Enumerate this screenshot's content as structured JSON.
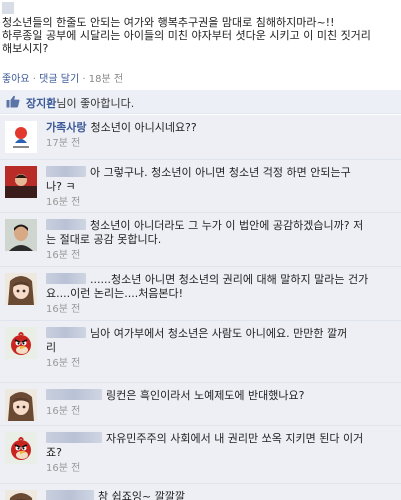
{
  "post": {
    "lines": [
      "청소년들의 한줄도 안되는 여가와 행복추구권을 맘대로 침해하지마라~!!",
      "하루종일 공부에 시달리는 아이들의 미친 야자부터 셧다운 시키고 이 미친 짓거리",
      "해보시지?"
    ],
    "actions": {
      "like": "좋아요",
      "sep": "·",
      "reply": "댓글 달기",
      "time": "18분 전"
    }
  },
  "likes": {
    "name": "장지환",
    "suffix": "님이 좋아합니다."
  },
  "comments": [
    {
      "author": "가족사랑",
      "author_blurred": false,
      "lines": [
        "청소년이 아니시네요??"
      ],
      "time": "17분 전",
      "avatar": "logo"
    },
    {
      "author": "",
      "author_blurred": true,
      "blur_w": 40,
      "lines": [
        "아 그렇구나. 청소년이 아니면 청소년 걱정 하면 안되는구",
        "나? ㅋ"
      ],
      "time": "16분 전",
      "avatar": "person-red"
    },
    {
      "author": "",
      "author_blurred": true,
      "blur_w": 40,
      "lines": [
        "청소년이 아니더라도 그 누가 이 법안에 공감하겠습니까? 저",
        "는 절대로 공감 못합니다."
      ],
      "time": "16분 전",
      "avatar": "person-dark"
    },
    {
      "author": "",
      "author_blurred": true,
      "blur_w": 40,
      "lines": [
        "......청소년 아니면 청소년의 권리에 대해 말하지 말라는 건가",
        "요....이런 논리는....처음본다!"
      ],
      "time": "16분 전",
      "avatar": "anime-girl"
    },
    {
      "author": "",
      "author_blurred": true,
      "blur_w": 40,
      "lines": [
        "님아 여가부에서 청소년은 사람도 아니에요. 만만한 깔꺼",
        "리"
      ],
      "time": "16분 전",
      "avatar": "angry-bird"
    },
    {
      "author": "",
      "author_blurred": true,
      "blur_w": 56,
      "lines": [
        "링컨은 흑인이라서 노예제도에 반대했나요?"
      ],
      "time": "16분 전",
      "avatar": "anime-girl"
    },
    {
      "author": "",
      "author_blurred": true,
      "blur_w": 56,
      "lines": [
        "자유민주주의 사회에서 내 권리만 쏘옥 지키면 된다 이거",
        "죠?"
      ],
      "time": "16분 전",
      "avatar": "angry-bird"
    },
    {
      "author": "",
      "author_blurred": true,
      "blur_w": 48,
      "lines": [
        "참 쉽죠잉~ 깔깔깔"
      ],
      "time": "",
      "avatar": "anime-girl"
    }
  ]
}
